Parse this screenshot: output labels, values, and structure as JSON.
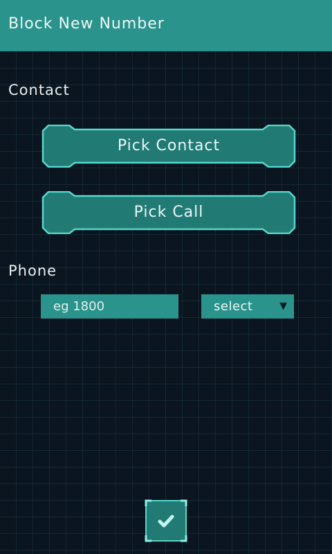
{
  "appbar": {
    "title": "Block New Number"
  },
  "contact_section": {
    "label": "Contact",
    "pick_contact_label": "Pick Contact",
    "pick_call_label": "Pick Call"
  },
  "phone_section": {
    "label": "Phone",
    "number_placeholder": "eg 1800",
    "number_value": "",
    "type_select": {
      "selected": "select",
      "arrow_icon": "triangle-down-icon"
    }
  },
  "confirm": {
    "icon": "checkmark-icon"
  },
  "colors": {
    "accent": "#2a938b",
    "accent_border": "#58d8cc",
    "background": "#0a1520",
    "text": "#eef8f7"
  }
}
